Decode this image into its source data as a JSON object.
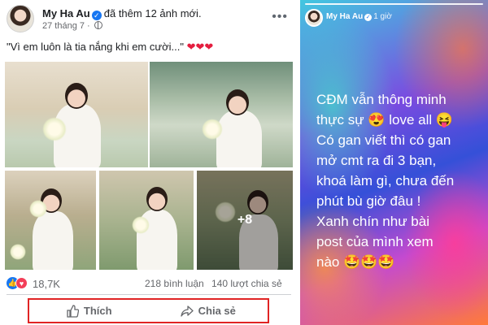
{
  "post": {
    "author_name": "My Ha Au",
    "action_text": "đã thêm 12 ảnh mới.",
    "date": "27 tháng 7",
    "caption": "\"Vì em luôn là tia nắng khi em cười...\"",
    "caption_emojis": "❤❤❤",
    "photo_more_label": "+8",
    "reaction_count": "18,7K",
    "comment_count": "218 bình luận",
    "share_count": "140 lượt chia sẻ",
    "like_button_label": "Thích",
    "share_button_label": "Chia sẻ",
    "icons": [
      "verified-icon",
      "globe-icon",
      "more-icon",
      "like-reaction-icon",
      "love-reaction-icon",
      "thumb-icon",
      "share-icon"
    ],
    "colors": {
      "accent": "#1877f2",
      "highlight_box": "#e02424",
      "love": "#f33e58"
    }
  },
  "story": {
    "author_name": "My Ha Au",
    "time": "1 giờ",
    "lines": [
      "CĐM vẫn thông minh",
      "thực sự 😍 love all 😝",
      "Có gan viết thì có gan",
      "mở cmt ra đi 3 bạn,",
      "khoá làm gì, chưa đến",
      "phút bù giờ đâu !",
      "Xanh chín như bài",
      "post của mình xem",
      "nào 🤩🤩🤩"
    ]
  }
}
